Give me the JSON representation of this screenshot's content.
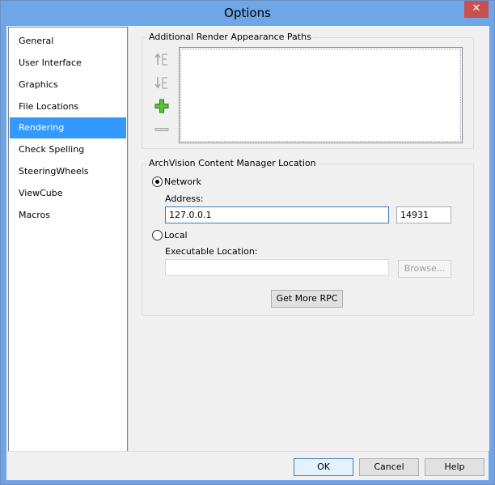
{
  "window": {
    "title": "Options",
    "close_glyph": "✕"
  },
  "sidebar": {
    "items": [
      {
        "label": "General"
      },
      {
        "label": "User Interface"
      },
      {
        "label": "Graphics"
      },
      {
        "label": "File Locations"
      },
      {
        "label": "Rendering",
        "selected": true
      },
      {
        "label": "Check Spelling"
      },
      {
        "label": "SteeringWheels"
      },
      {
        "label": "ViewCube"
      },
      {
        "label": "Macros"
      }
    ]
  },
  "render_paths": {
    "group_label": "Additional Render Appearance Paths",
    "icons": [
      "move-up-icon",
      "move-down-icon",
      "add-icon",
      "remove-icon"
    ]
  },
  "archvision": {
    "group_label": "ArchVision Content Manager Location",
    "network_label": "Network",
    "network_checked": true,
    "address_label": "Address:",
    "address_value": "127.0.0.1",
    "port_value": "14931",
    "local_label": "Local",
    "local_checked": false,
    "executable_label": "Executable Location:",
    "executable_value": "",
    "browse_label": "Browse...",
    "get_more_label": "Get More RPC"
  },
  "footer": {
    "ok_label": "OK",
    "cancel_label": "Cancel",
    "help_label": "Help"
  },
  "colors": {
    "titlebar": "#6ea6e8",
    "selection": "#3399ff",
    "close": "#c75050",
    "add_icon": "#3a9d23"
  }
}
